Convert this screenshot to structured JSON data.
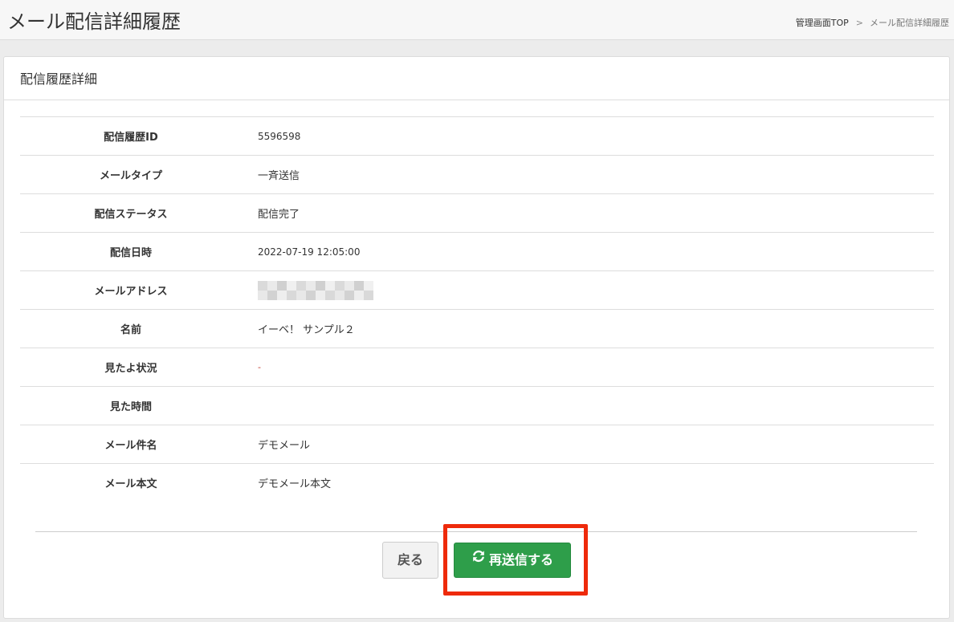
{
  "header": {
    "title": "メール配信詳細履歴",
    "breadcrumb": {
      "home": "管理画面TOP",
      "separator": ">",
      "current": "メール配信詳細履歴"
    }
  },
  "panel": {
    "title": "配信履歴詳細",
    "rows": [
      {
        "label": "配信履歴ID",
        "value": "5596598"
      },
      {
        "label": "メールタイプ",
        "value": "一斉送信"
      },
      {
        "label": "配信ステータス",
        "value": "配信完了"
      },
      {
        "label": "配信日時",
        "value": "2022-07-19 12:05:00"
      },
      {
        "label": "メールアドレス",
        "value": ""
      },
      {
        "label": "名前",
        "value": "イーベ！ サンプル２"
      },
      {
        "label": "見たよ状況",
        "value": "-"
      },
      {
        "label": "見た時間",
        "value": ""
      },
      {
        "label": "メール件名",
        "value": "デモメール"
      },
      {
        "label": "メール本文",
        "value": "デモメール本文"
      }
    ]
  },
  "actions": {
    "back_label": "戻る",
    "resend_label": "再送信する",
    "resend_icon": "refresh-icon"
  },
  "colors": {
    "resend_button": "#2e9e4a",
    "highlight": "#ee2a0b",
    "dash_value": "#c0392b"
  }
}
